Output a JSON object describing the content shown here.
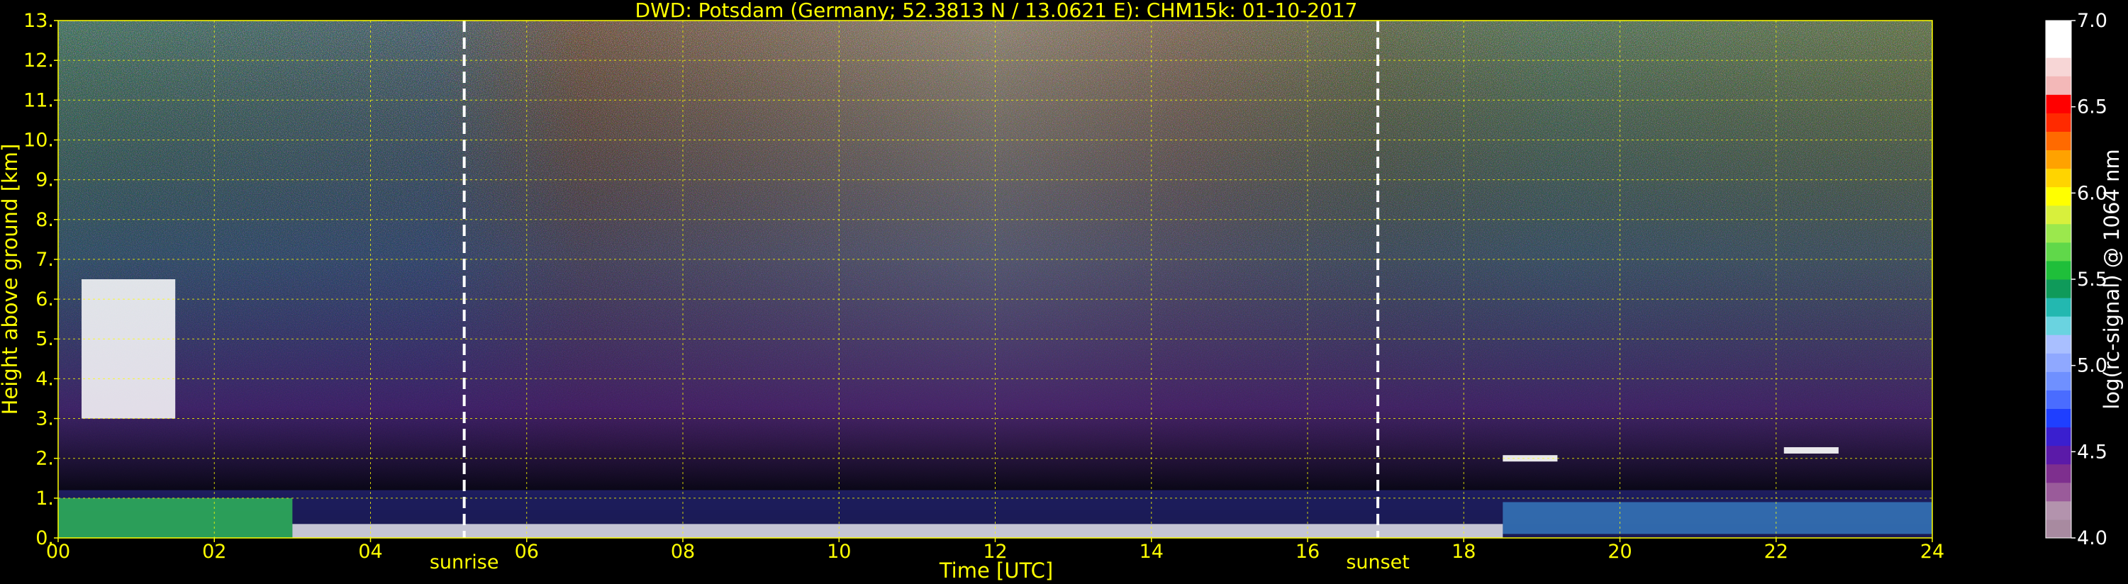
{
  "chart_data": {
    "type": "heatmap",
    "title": "DWD: Potsdam (Germany; 52.3813 N / 13.0621 E):    CHM15k: 01-10-2017",
    "xlabel": "Time [UTC]",
    "ylabel": "Height above ground [km]",
    "xlim": [
      0,
      24
    ],
    "ylim": [
      0,
      13
    ],
    "x_ticks": [
      "00",
      "02",
      "04",
      "06",
      "08",
      "10",
      "12",
      "14",
      "16",
      "18",
      "20",
      "22",
      "24"
    ],
    "y_ticks": [
      "0.",
      "1.",
      "2.",
      "3.",
      "4.",
      "5.",
      "6.",
      "7.",
      "8.",
      "9.",
      "10.",
      "11.",
      "12.",
      "13."
    ],
    "grid": true,
    "events": [
      {
        "label": "sunrise",
        "time": 5.2
      },
      {
        "label": "sunset",
        "time": 16.9
      }
    ],
    "colorbar": {
      "label": "log(rc-signal) @ 1064 nm",
      "range": [
        4.0,
        7.0
      ],
      "ticks": [
        "4.0",
        "4.5",
        "5.0",
        "5.5",
        "6.0",
        "6.5",
        "7.0"
      ],
      "colors": [
        "#a88aa0",
        "#b393ad",
        "#9a5b9a",
        "#7e2f8e",
        "#5b1aa8",
        "#3a1fcf",
        "#1f3fff",
        "#4a6cff",
        "#6f90ff",
        "#8fa8ff",
        "#a9bfff",
        "#6ad3e0",
        "#23b8b0",
        "#0f9a5a",
        "#1fbf3a",
        "#60d84a",
        "#9be84d",
        "#d8f03c",
        "#ffff00",
        "#ffd400",
        "#ffa200",
        "#ff6a00",
        "#ff2a00",
        "#ff0000",
        "#f3b8b8",
        "#f7d6d6",
        "#ffffff",
        "#ffffff"
      ]
    },
    "features": [
      {
        "label": "boundary-layer aerosol",
        "time_range": [
          0,
          24
        ],
        "height_km": [
          0,
          1.2
        ]
      },
      {
        "label": "cloud",
        "time": 0.3,
        "height_km": [
          3.0,
          6.5
        ]
      },
      {
        "label": "cloud",
        "time": 18.5,
        "height_km": 2.0
      },
      {
        "label": "cloud",
        "time": 22.1,
        "height_km": 2.2
      }
    ]
  }
}
